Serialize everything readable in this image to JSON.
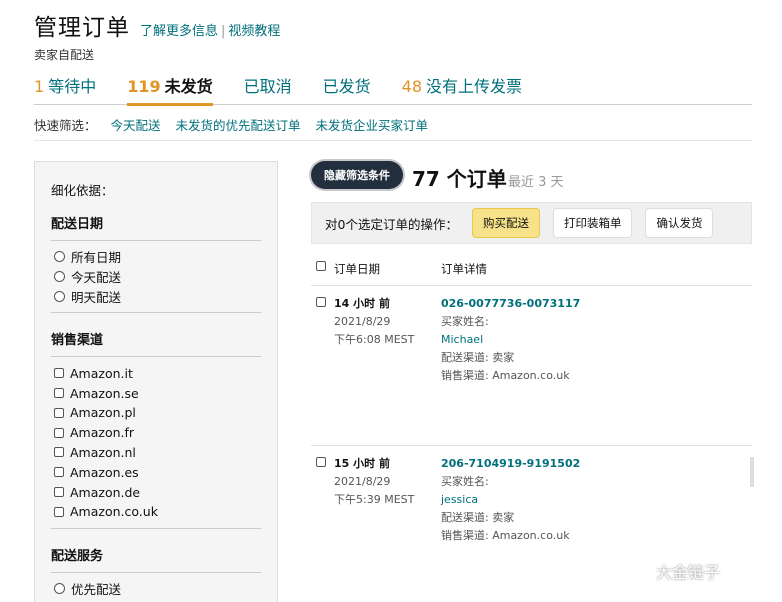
{
  "header": {
    "title": "管理订单",
    "link_more": "了解更多信息",
    "separator": "|",
    "link_video": "视频教程",
    "subtitle": "卖家自配送"
  },
  "tabs": [
    {
      "count": "1",
      "label": "等待中"
    },
    {
      "count": "119",
      "label": "未发货"
    },
    {
      "count": "",
      "label": "已取消"
    },
    {
      "count": "",
      "label": "已发货"
    },
    {
      "count": "48",
      "label": "没有上传发票"
    }
  ],
  "quick_filter": {
    "label": "快速筛选：",
    "links": [
      "今天配送",
      "未发货的优先配送订单",
      "未发货企业买家订单"
    ]
  },
  "sidebar": {
    "refine_label": "细化依据：",
    "delivery_date": {
      "heading": "配送日期",
      "options": [
        "所有日期",
        "今天配送",
        "明天配送"
      ]
    },
    "sales_channel": {
      "heading": "销售渠道",
      "options": [
        "Amazon.it",
        "Amazon.se",
        "Amazon.pl",
        "Amazon.fr",
        "Amazon.nl",
        "Amazon.es",
        "Amazon.de",
        "Amazon.co.uk"
      ]
    },
    "delivery_service": {
      "heading": "配送服务",
      "options": [
        "优先配送"
      ]
    }
  },
  "main": {
    "hide_filters_button": "隐藏筛选条件",
    "order_count": "77 个订单",
    "recent_range": "最近 3 天",
    "action_label": "对0个选定订单的操作：",
    "buttons": {
      "buy_shipping": "购买配送",
      "print_packing": "打印装箱单",
      "confirm_ship": "确认发货"
    },
    "columns": {
      "date": "订单日期",
      "details": "订单详情"
    },
    "orders": [
      {
        "age": "14 小时 前",
        "date": "2021/8/29",
        "time": "下午6:08 MEST",
        "order_id": "026-0077736-0073117",
        "buyer_label": "买家姓名:",
        "buyer": "Michael",
        "fulfillment": "配送渠道: 卖家",
        "channel": "销售渠道: Amazon.co.uk"
      },
      {
        "age": "15 小时 前",
        "date": "2021/8/29",
        "time": "下午5:39 MEST",
        "order_id": "206-7104919-9191502",
        "buyer_label": "买家姓名:",
        "buyer": "jessica",
        "fulfillment": "配送渠道: 卖家",
        "channel": "销售渠道: Amazon.co.uk"
      }
    ]
  },
  "watermark": {
    "text": "大金链子",
    "icon": "wechat-icon"
  },
  "colors": {
    "accent": "#00707b",
    "orange": "#e39426",
    "dark_button": "#232f3e",
    "primary_button": "#f7e28a"
  }
}
